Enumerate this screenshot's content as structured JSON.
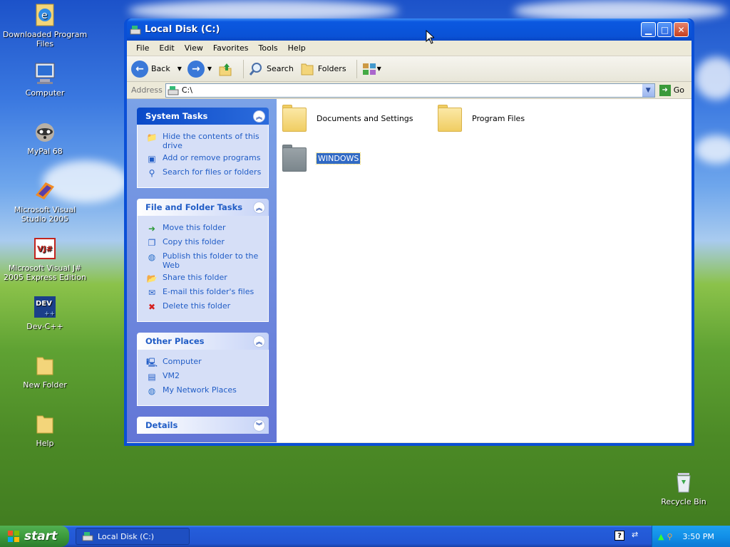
{
  "desktop": {
    "icons": [
      {
        "label": "Downloaded Program Files"
      },
      {
        "label": "Computer"
      },
      {
        "label": "MyPal 68"
      },
      {
        "label": "Microsoft Visual Studio 2005"
      },
      {
        "label": "Microsoft Visual J# 2005 Express Edition"
      },
      {
        "label": "Dev-C++"
      },
      {
        "label": "New Folder"
      },
      {
        "label": "Help"
      }
    ],
    "recycle_bin": "Recycle Bin"
  },
  "window": {
    "title": "Local Disk (C:)",
    "menu": [
      "File",
      "Edit",
      "View",
      "Favorites",
      "Tools",
      "Help"
    ],
    "toolbar": {
      "back": "Back",
      "search": "Search",
      "folders": "Folders"
    },
    "address": {
      "label": "Address",
      "value": "C:\\",
      "go": "Go"
    },
    "tasks": {
      "system": {
        "title": "System Tasks",
        "items": [
          "Hide the contents of this drive",
          "Add or remove programs",
          "Search for files or folders"
        ]
      },
      "file_folder": {
        "title": "File and Folder Tasks",
        "items": [
          "Move this folder",
          "Copy this folder",
          "Publish this folder to the Web",
          "Share this folder",
          "E-mail this folder's files",
          "Delete this folder"
        ]
      },
      "other": {
        "title": "Other Places",
        "items": [
          "Computer",
          "VM2",
          "My Network Places"
        ]
      },
      "details": {
        "title": "Details"
      }
    },
    "files": [
      {
        "name": "Documents and Settings"
      },
      {
        "name": "Program Files"
      },
      {
        "name": "WINDOWS"
      }
    ]
  },
  "taskbar": {
    "start": "start",
    "task": "Local Disk (C:)",
    "time": "3:50 PM"
  },
  "colors": {
    "accent": "#0a4fd6",
    "task_link": "#215dc6",
    "selection": "#316ac5"
  }
}
